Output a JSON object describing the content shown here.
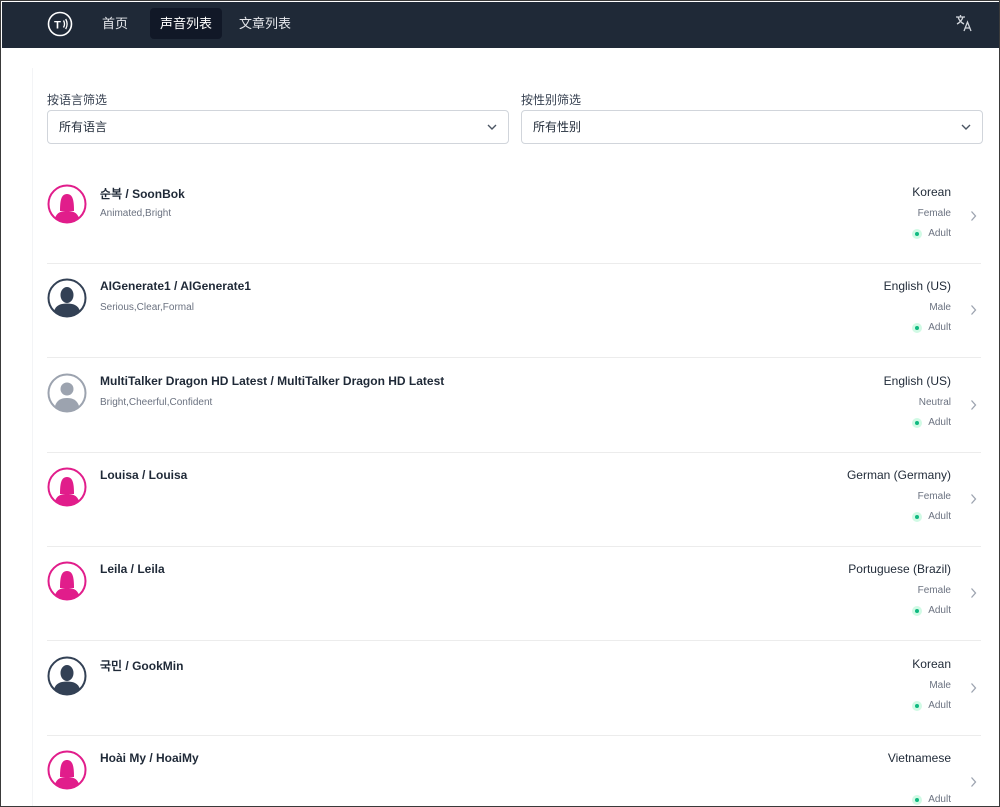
{
  "nav": {
    "tabs": [
      {
        "label": "首页"
      },
      {
        "label": "声音列表"
      },
      {
        "label": "文章列表"
      }
    ],
    "logo_text": "T",
    "translate_icon": "translate-icon"
  },
  "filters": {
    "language": {
      "label": "按语言筛选",
      "value": "所有语言"
    },
    "gender": {
      "label": "按性别筛选",
      "value": "所有性别"
    }
  },
  "colors": {
    "navbar": "#1f2937",
    "female_avatar": "#e11d8b",
    "male_avatar": "#334155",
    "neutral_avatar": "#9ca3af",
    "adult_dot": "#10b981"
  },
  "voices": [
    {
      "name": "순복 / SoonBok",
      "tags": "Animated,Bright",
      "language": "Korean",
      "gender": "Female",
      "age": "Adult",
      "avatar": "female-avatar-icon"
    },
    {
      "name": "AIGenerate1 / AIGenerate1",
      "tags": "Serious,Clear,Formal",
      "language": "English (US)",
      "gender": "Male",
      "age": "Adult",
      "avatar": "male-avatar-icon"
    },
    {
      "name": "MultiTalker Dragon HD Latest / MultiTalker Dragon HD Latest",
      "tags": "Bright,Cheerful,Confident",
      "language": "English (US)",
      "gender": "Neutral",
      "age": "Adult",
      "avatar": "neutral-avatar-icon"
    },
    {
      "name": "Louisa / Louisa",
      "tags": "",
      "language": "German (Germany)",
      "gender": "Female",
      "age": "Adult",
      "avatar": "female-avatar-icon"
    },
    {
      "name": "Leila / Leila",
      "tags": "",
      "language": "Portuguese (Brazil)",
      "gender": "Female",
      "age": "Adult",
      "avatar": "female-avatar-icon"
    },
    {
      "name": "국민 / GookMin",
      "tags": "",
      "language": "Korean",
      "gender": "Male",
      "age": "Adult",
      "avatar": "male-avatar-icon"
    },
    {
      "name": "Hoài My / HoaiMy",
      "tags": "",
      "language": "Vietnamese",
      "gender": "",
      "age": "Adult",
      "avatar": "female-avatar-icon"
    }
  ]
}
